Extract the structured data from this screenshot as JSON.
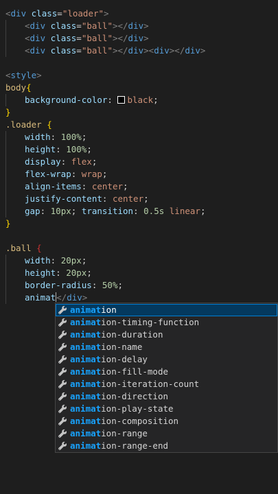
{
  "editor": {
    "lines": [
      {
        "parts": [
          {
            "c": "punc",
            "t": "<"
          },
          {
            "c": "tag",
            "t": "div"
          },
          {
            "c": "text",
            "t": " "
          },
          {
            "c": "attr",
            "t": "class"
          },
          {
            "c": "text",
            "t": "="
          },
          {
            "c": "str",
            "t": "\"loader\""
          },
          {
            "c": "punc",
            "t": ">"
          }
        ]
      },
      {
        "indent": 1,
        "parts": [
          {
            "c": "punc",
            "t": "<"
          },
          {
            "c": "tag",
            "t": "div"
          },
          {
            "c": "text",
            "t": " "
          },
          {
            "c": "attr",
            "t": "class"
          },
          {
            "c": "text",
            "t": "="
          },
          {
            "c": "str",
            "t": "\"ball\""
          },
          {
            "c": "punc",
            "t": "></"
          },
          {
            "c": "tag",
            "t": "div"
          },
          {
            "c": "punc",
            "t": ">"
          }
        ]
      },
      {
        "indent": 1,
        "parts": [
          {
            "c": "punc",
            "t": "<"
          },
          {
            "c": "tag",
            "t": "div"
          },
          {
            "c": "text",
            "t": " "
          },
          {
            "c": "attr",
            "t": "class"
          },
          {
            "c": "text",
            "t": "="
          },
          {
            "c": "str",
            "t": "\"ball\""
          },
          {
            "c": "punc",
            "t": "></"
          },
          {
            "c": "tag",
            "t": "div"
          },
          {
            "c": "punc",
            "t": ">"
          }
        ]
      },
      {
        "indent": 1,
        "parts": [
          {
            "c": "punc",
            "t": "<"
          },
          {
            "c": "tag",
            "t": "div"
          },
          {
            "c": "text",
            "t": " "
          },
          {
            "c": "attr",
            "t": "class"
          },
          {
            "c": "text",
            "t": "="
          },
          {
            "c": "str",
            "t": "\"ball\""
          },
          {
            "c": "punc",
            "t": "></"
          },
          {
            "c": "tag",
            "t": "div"
          },
          {
            "c": "punc",
            "t": "><"
          },
          {
            "c": "tag",
            "t": "div"
          },
          {
            "c": "punc",
            "t": "></"
          },
          {
            "c": "tag",
            "t": "div"
          },
          {
            "c": "punc",
            "t": ">"
          }
        ]
      },
      {
        "parts": []
      },
      {
        "parts": [
          {
            "c": "punc",
            "t": "<"
          },
          {
            "c": "tag",
            "t": "style"
          },
          {
            "c": "punc",
            "t": ">"
          }
        ]
      },
      {
        "parts": [
          {
            "c": "sel",
            "t": "body"
          },
          {
            "c": "brace",
            "t": "{"
          }
        ]
      },
      {
        "indent": 1,
        "parts": [
          {
            "c": "prop",
            "t": "background-color"
          },
          {
            "c": "text",
            "t": ": "
          },
          {
            "c": "swatch",
            "t": ""
          },
          {
            "c": "val",
            "t": "black"
          },
          {
            "c": "text",
            "t": ";"
          }
        ]
      },
      {
        "parts": [
          {
            "c": "brace",
            "t": "}"
          }
        ]
      },
      {
        "parts": [
          {
            "c": "sel",
            "t": ".loader"
          },
          {
            "c": "text",
            "t": " "
          },
          {
            "c": "brace",
            "t": "{"
          }
        ]
      },
      {
        "indent": 1,
        "parts": [
          {
            "c": "prop",
            "t": "width"
          },
          {
            "c": "text",
            "t": ": "
          },
          {
            "c": "num",
            "t": "100%"
          },
          {
            "c": "text",
            "t": ";"
          }
        ]
      },
      {
        "indent": 1,
        "parts": [
          {
            "c": "prop",
            "t": "height"
          },
          {
            "c": "text",
            "t": ": "
          },
          {
            "c": "num",
            "t": "100%"
          },
          {
            "c": "text",
            "t": ";"
          }
        ]
      },
      {
        "indent": 1,
        "parts": [
          {
            "c": "prop",
            "t": "display"
          },
          {
            "c": "text",
            "t": ": "
          },
          {
            "c": "val",
            "t": "flex"
          },
          {
            "c": "text",
            "t": ";"
          }
        ]
      },
      {
        "indent": 1,
        "parts": [
          {
            "c": "prop",
            "t": "flex-wrap"
          },
          {
            "c": "text",
            "t": ": "
          },
          {
            "c": "val",
            "t": "wrap"
          },
          {
            "c": "text",
            "t": ";"
          }
        ]
      },
      {
        "indent": 1,
        "parts": [
          {
            "c": "prop",
            "t": "align-items"
          },
          {
            "c": "text",
            "t": ": "
          },
          {
            "c": "val",
            "t": "center"
          },
          {
            "c": "text",
            "t": ";"
          }
        ]
      },
      {
        "indent": 1,
        "parts": [
          {
            "c": "prop",
            "t": "justify-content"
          },
          {
            "c": "text",
            "t": ": "
          },
          {
            "c": "val",
            "t": "center"
          },
          {
            "c": "text",
            "t": ";"
          }
        ]
      },
      {
        "indent": 1,
        "parts": [
          {
            "c": "prop",
            "t": "gap"
          },
          {
            "c": "text",
            "t": ": "
          },
          {
            "c": "num",
            "t": "10px"
          },
          {
            "c": "text",
            "t": "; "
          },
          {
            "c": "prop",
            "t": "transition"
          },
          {
            "c": "text",
            "t": ": "
          },
          {
            "c": "num",
            "t": "0.5s"
          },
          {
            "c": "text",
            "t": " "
          },
          {
            "c": "val",
            "t": "linear"
          },
          {
            "c": "text",
            "t": ";"
          }
        ]
      },
      {
        "parts": [
          {
            "c": "brace",
            "t": "}"
          }
        ]
      },
      {
        "parts": []
      },
      {
        "parts": [
          {
            "c": "sel",
            "t": ".ball"
          },
          {
            "c": "text",
            "t": " "
          },
          {
            "c": "brace-dim",
            "t": "{"
          }
        ]
      },
      {
        "indent": 1,
        "parts": [
          {
            "c": "prop",
            "t": "width"
          },
          {
            "c": "text",
            "t": ": "
          },
          {
            "c": "num",
            "t": "20px"
          },
          {
            "c": "text",
            "t": ";"
          }
        ]
      },
      {
        "indent": 1,
        "parts": [
          {
            "c": "prop",
            "t": "height"
          },
          {
            "c": "text",
            "t": ": "
          },
          {
            "c": "num",
            "t": "20px"
          },
          {
            "c": "text",
            "t": ";"
          }
        ]
      },
      {
        "indent": 1,
        "parts": [
          {
            "c": "prop",
            "t": "border-radius"
          },
          {
            "c": "text",
            "t": ": "
          },
          {
            "c": "num",
            "t": "50%"
          },
          {
            "c": "text",
            "t": ";"
          }
        ]
      },
      {
        "indent": 1,
        "parts": [
          {
            "c": "prop",
            "t": "animat"
          },
          {
            "c": "cursor",
            "t": ""
          },
          {
            "c": "punc",
            "t": "</"
          },
          {
            "c": "tag",
            "t": "div"
          },
          {
            "c": "punc",
            "t": ">"
          }
        ]
      }
    ]
  },
  "suggest": {
    "query": "animat",
    "items": [
      {
        "match": "animat",
        "rest": "ion",
        "selected": true
      },
      {
        "match": "animat",
        "rest": "ion-timing-function"
      },
      {
        "match": "animat",
        "rest": "ion-duration"
      },
      {
        "match": "animat",
        "rest": "ion-name"
      },
      {
        "match": "animat",
        "rest": "ion-delay"
      },
      {
        "match": "animat",
        "rest": "ion-fill-mode"
      },
      {
        "match": "animat",
        "rest": "ion-iteration-count"
      },
      {
        "match": "animat",
        "rest": "ion-direction"
      },
      {
        "match": "animat",
        "rest": "ion-play-state"
      },
      {
        "match": "animat",
        "rest": "ion-composition"
      },
      {
        "match": "animat",
        "rest": "ion-range"
      },
      {
        "match": "animat",
        "rest": "ion-range-end"
      }
    ],
    "icon": "wrench-icon"
  },
  "colors": {
    "background": "#1e1e1e",
    "match": "#18a3ff",
    "selected_bg": "#04395e"
  }
}
